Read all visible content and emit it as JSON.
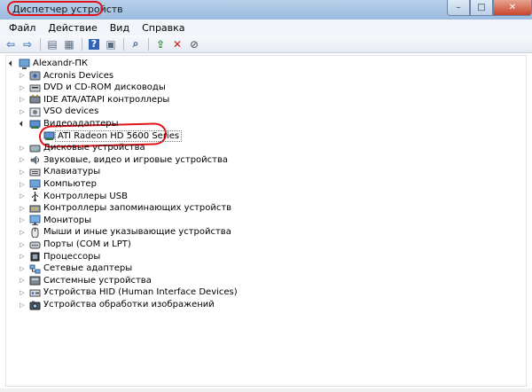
{
  "window": {
    "title": "Диспетчер устройств",
    "controls": {
      "minimize": "–",
      "maximize": "□",
      "close": "✕"
    }
  },
  "menu": [
    "Файл",
    "Действие",
    "Вид",
    "Справка"
  ],
  "toolbar": {
    "buttons": [
      {
        "name": "back-icon",
        "glyph": "⇦"
      },
      {
        "name": "forward-icon",
        "glyph": "⇨"
      },
      {
        "sep": true
      },
      {
        "name": "show-hide-console-tree-icon",
        "glyph": "▤"
      },
      {
        "name": "properties-icon",
        "glyph": "▦"
      },
      {
        "sep": true
      },
      {
        "name": "help-icon",
        "glyph": "?"
      },
      {
        "name": "view-icon",
        "glyph": "▣"
      },
      {
        "sep": true
      },
      {
        "name": "scan-hardware-icon",
        "glyph": "⌕"
      },
      {
        "sep": true
      },
      {
        "name": "update-driver-icon",
        "glyph": "⇪"
      },
      {
        "name": "uninstall-icon",
        "glyph": "✕"
      },
      {
        "name": "disable-icon",
        "glyph": "⊘"
      }
    ]
  },
  "tree": {
    "root": "Alexandr-ПК",
    "items": [
      {
        "label": "Acronis Devices",
        "icon": "acronis-icon",
        "expanded": false
      },
      {
        "label": "DVD и CD-ROM дисководы",
        "icon": "dvd-icon",
        "expanded": false
      },
      {
        "label": "IDE ATA/ATAPI контроллеры",
        "icon": "ide-icon",
        "expanded": false
      },
      {
        "label": "VSO devices",
        "icon": "vso-icon",
        "expanded": false
      },
      {
        "label": "Видеоадаптеры",
        "icon": "display-adapter-icon",
        "expanded": true,
        "children": [
          {
            "label": "ATI Radeon HD 5600 Series",
            "icon": "display-adapter-icon"
          }
        ]
      },
      {
        "label": "Дисковые устройства",
        "icon": "disk-icon",
        "expanded": false
      },
      {
        "label": "Звуковые, видео и игровые устройства",
        "icon": "sound-icon",
        "expanded": false
      },
      {
        "label": "Клавиатуры",
        "icon": "keyboard-icon",
        "expanded": false
      },
      {
        "label": "Компьютер",
        "icon": "computer-icon",
        "expanded": false
      },
      {
        "label": "Контроллеры USB",
        "icon": "usb-icon",
        "expanded": false
      },
      {
        "label": "Контроллеры запоминающих устройств",
        "icon": "storage-icon",
        "expanded": false
      },
      {
        "label": "Мониторы",
        "icon": "monitor-icon",
        "expanded": false
      },
      {
        "label": "Мыши и иные указывающие устройства",
        "icon": "mouse-icon",
        "expanded": false
      },
      {
        "label": "Порты (COM и LPT)",
        "icon": "port-icon",
        "expanded": false
      },
      {
        "label": "Процессоры",
        "icon": "processor-icon",
        "expanded": false
      },
      {
        "label": "Сетевые адаптеры",
        "icon": "network-icon",
        "expanded": false
      },
      {
        "label": "Системные устройства",
        "icon": "system-icon",
        "expanded": false
      },
      {
        "label": "Устройства HID (Human Interface Devices)",
        "icon": "hid-icon",
        "expanded": false
      },
      {
        "label": "Устройства обработки изображений",
        "icon": "imaging-icon",
        "expanded": false
      }
    ]
  },
  "colors": {
    "highlight": "#e0131a",
    "titlebar": "#a6c3e3"
  }
}
